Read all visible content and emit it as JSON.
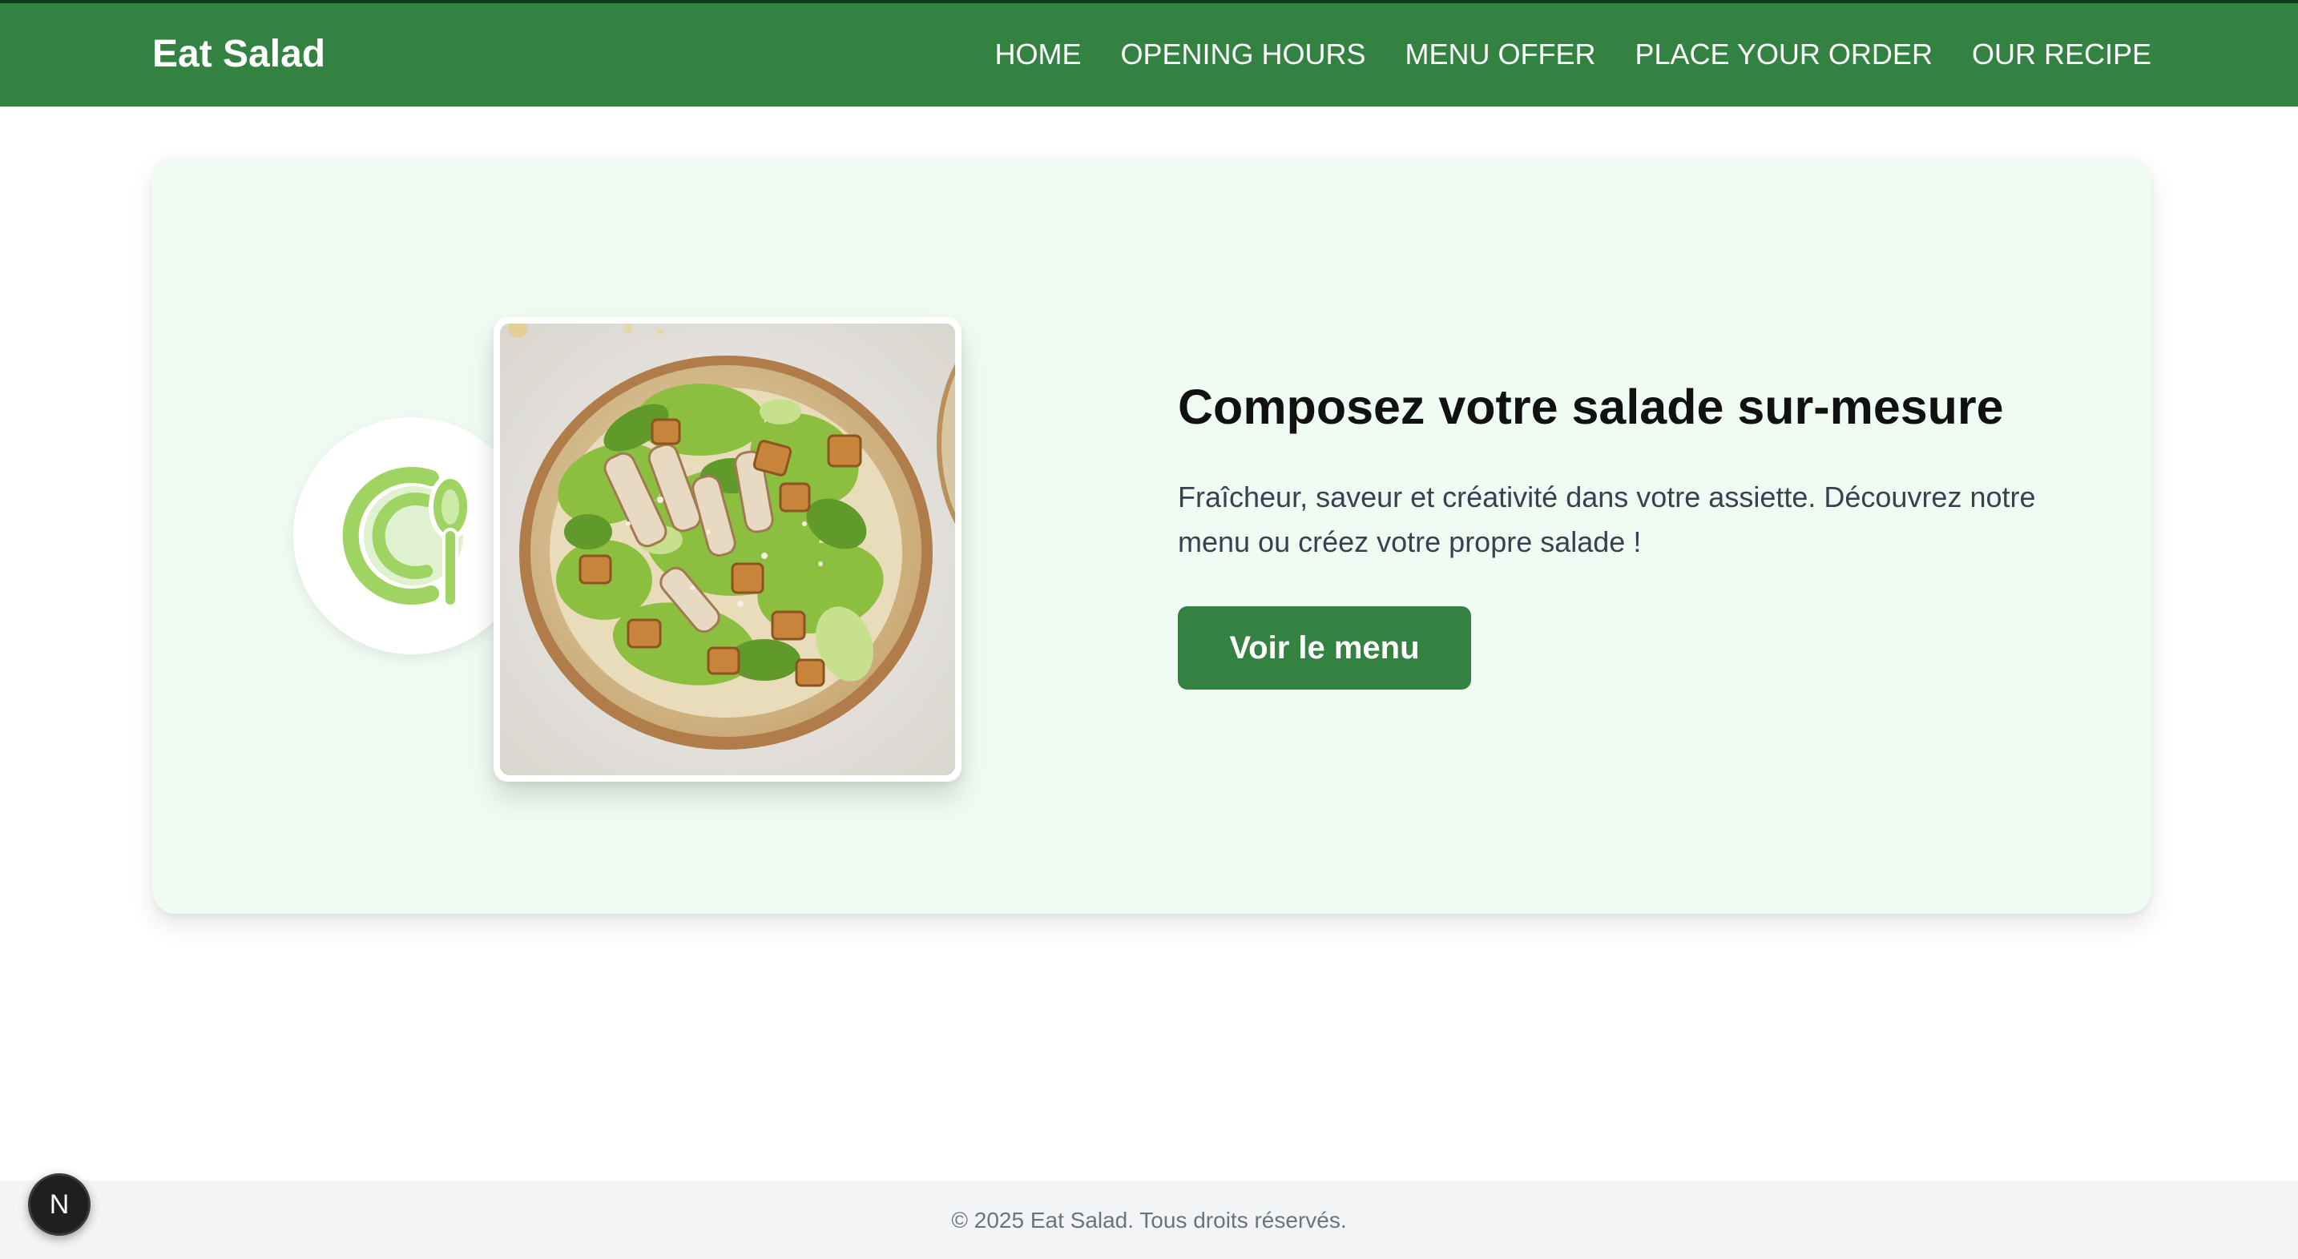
{
  "header": {
    "brand": "Eat Salad",
    "nav": [
      "HOME",
      "OPENING HOURS",
      "MENU OFFER",
      "PLACE YOUR ORDER",
      "OUR RECIPE"
    ]
  },
  "hero": {
    "title": "Composez votre salade sur-mesure",
    "description": "Fraîcheur, saveur et créativité dans votre assiette. Découvrez notre menu ou créez votre propre salade !",
    "cta_label": "Voir le menu",
    "logo_icon": "salad-logo-icon",
    "image": "caesar-salad-bowl-photo"
  },
  "footer": {
    "copyright": "© 2025 Eat Salad. Tous droits réservés."
  },
  "dev_badge": {
    "label": "N",
    "icon": "nextjs-dev-indicator-icon"
  },
  "colors": {
    "primary": "#348242",
    "hero_bg": "#f0fbf3",
    "logo_green": "#9fd462",
    "footer_bg": "#f3f4f6"
  }
}
